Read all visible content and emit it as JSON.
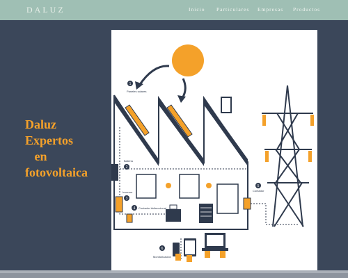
{
  "header": {
    "logo": "DALUZ",
    "nav": [
      {
        "label": "Inicio"
      },
      {
        "label": "Particulares"
      },
      {
        "label": "Empresas"
      },
      {
        "label": "Productos"
      }
    ]
  },
  "hero": {
    "lines": [
      "Daluz",
      "Expertos",
      "   en",
      "fotovoltaica"
    ]
  },
  "diagram": {
    "labels": {
      "paneles": "Paneles solares",
      "bateria": "Batería",
      "inversor": "Inversor",
      "contador_bi": "Contador bidireccional",
      "contador": "Contador",
      "monitorizacion": "Monitorización"
    },
    "numbers": [
      "1",
      "2",
      "3",
      "4",
      "5",
      "6"
    ],
    "colors": {
      "accent": "#f4a12a",
      "dark": "#2f3a4d"
    }
  }
}
